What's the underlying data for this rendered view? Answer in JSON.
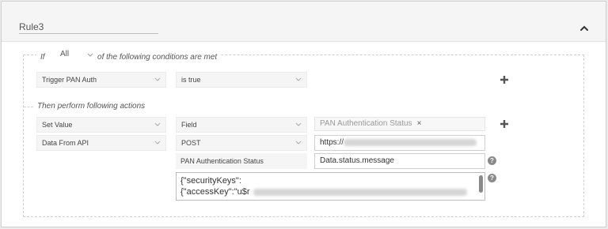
{
  "rule": {
    "title": "Rule3"
  },
  "conditions": {
    "if_label": "If",
    "match": "All",
    "suffix": "of the following conditions are met",
    "row": {
      "field": "Trigger PAN Auth",
      "operator": "is true"
    }
  },
  "actions": {
    "legend": "Then perform following actions",
    "row1": {
      "type": "Set Value",
      "target": "Field",
      "tag": "PAN Authentication Status",
      "tag_remove": "×"
    },
    "row2": {
      "type": "Data From API",
      "method": "POST",
      "url": "https://"
    },
    "row3": {
      "label": "PAN Authentication Status",
      "path": "Data.status.message",
      "help": "?"
    },
    "row4": {
      "body_line1": "{\"securityKeys\":",
      "body_line2": "{\"accessKey\":\"u$r",
      "help": "?"
    }
  },
  "icons": {
    "collapse": "chevron-up-icon",
    "add": "plus-icon",
    "help": "help-circle-icon",
    "dropdown": "chevron-down-icon"
  },
  "colors": {
    "header_bg": "#f5f5f5",
    "field_bg": "#f5f5f5",
    "help_bg": "#8a8a8a"
  }
}
